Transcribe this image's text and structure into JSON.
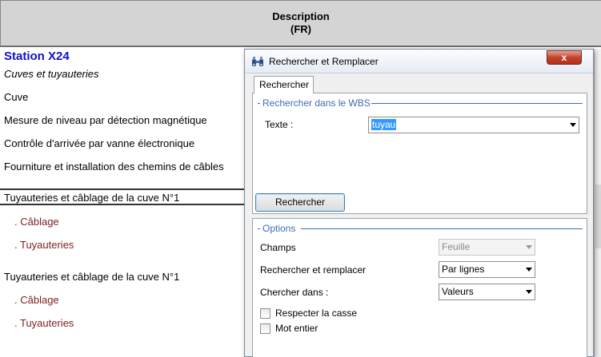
{
  "sheet": {
    "header_line1": "Description",
    "header_line2": "(FR)",
    "rows": [
      "Station X24",
      "Cuves et tuyauteries",
      "Cuve",
      "Mesure de niveau par détection magnétique",
      "Contrôle d'arrivée par vanne électronique",
      "Fourniture et installation des chemins de câbles",
      "Tuyauteries et câblage de la cuve N°1",
      ". Câblage",
      ". Tuyauteries",
      "Tuyauteries et câblage de la cuve N°1",
      ". Câblage",
      ". Tuyauteries"
    ]
  },
  "dialog": {
    "title": "Rechercher et Remplacer",
    "close_label": "x",
    "tab_label": "Rechercher",
    "search_group_legend": "Rechercher dans le WBS",
    "text_label": "Texte :",
    "text_value": "tuyau",
    "search_button": "Rechercher",
    "options_legend": "Options",
    "champs_label": "Champs",
    "champs_value": "Feuille",
    "replace_label": "Rechercher et remplacer",
    "replace_value": "Par lignes",
    "look_in_label": "Chercher dans :",
    "look_in_value": "Valeurs",
    "match_case_label": "Respecter la casse",
    "whole_word_label": "Mot entier"
  },
  "colors": {
    "station_title": "#1111cc",
    "sub_item": "#7a1f1f",
    "group_legend": "#3d6db5",
    "close_button": "#c4432b"
  },
  "icons": {
    "title_icon": "binoculars-icon"
  }
}
